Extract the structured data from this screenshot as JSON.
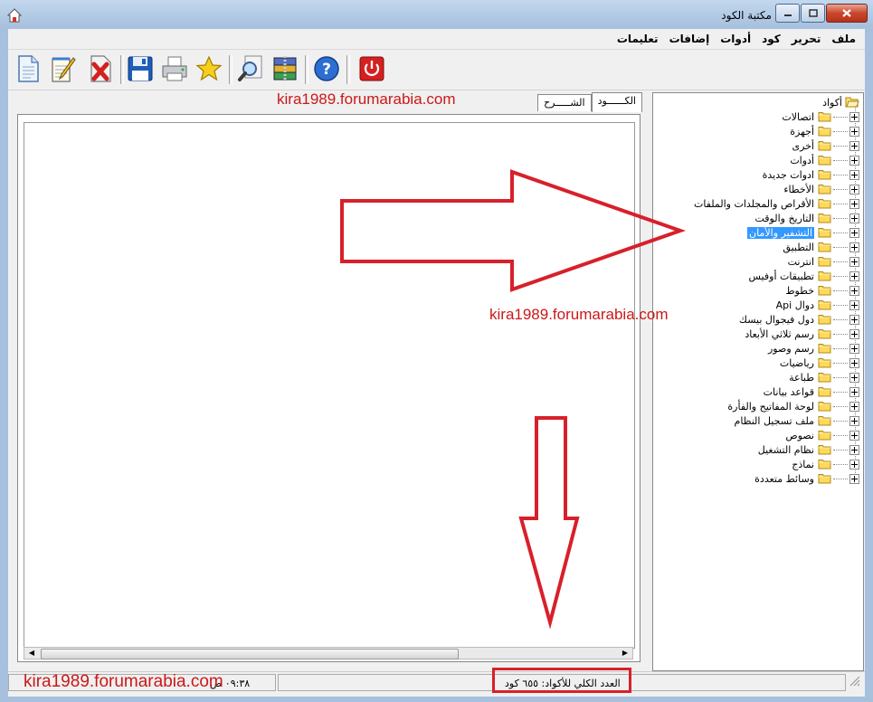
{
  "window": {
    "title": "مكتبة الكود"
  },
  "menu": [
    "ملف",
    "تحرير",
    "كود",
    "أدوات",
    "إضافات",
    "تعليمات"
  ],
  "toolbar": [
    {
      "name": "new-document",
      "icon": "document-icon"
    },
    {
      "name": "edit",
      "icon": "notepad-pencil-icon"
    },
    {
      "name": "delete",
      "icon": "red-x-icon"
    },
    {
      "name": "save",
      "icon": "floppy-disk-icon"
    },
    {
      "name": "print",
      "icon": "printer-icon"
    },
    {
      "name": "favorites",
      "icon": "star-icon"
    },
    {
      "name": "search",
      "icon": "magnifier-icon"
    },
    {
      "name": "archive",
      "icon": "winzip-icon"
    },
    {
      "name": "help",
      "icon": "question-icon"
    },
    {
      "name": "exit",
      "icon": "power-icon"
    }
  ],
  "tabs": {
    "code": "الكــــــود",
    "explanation": "الشـــــرح"
  },
  "watermark": "kira1989.forumarabia.com",
  "tree": {
    "root": "أكواد",
    "items": [
      "اتصالات",
      "أجهزة",
      "أخرى",
      "أدوات",
      "ادوات جديدة",
      "الأخطاء",
      "الأقراص والمجلدات والملفات",
      "التاريخ والوقت",
      "التشفير والأمان",
      "التطبيق",
      "انترنت",
      "تطبيقات أوفيس",
      "خطوط",
      "دوال Api",
      "دول فيجوال بيسك",
      "رسم ثلاثي الأبعاد",
      "رسم وصور",
      "رياضيات",
      "طباعة",
      "قواعد بيانات",
      "لوحة المفاتيح والفأرة",
      "ملف تسجيل النظام",
      "نصوص",
      "نظام التشغيل",
      "نماذج",
      "وسائط متعددة"
    ],
    "selected_index": 8
  },
  "status": {
    "total_codes": "العدد الكلي للأكواد: ٦٥٥ كود",
    "time": "٠٩:٣٨ ص"
  },
  "colors": {
    "annotation_red": "#d8202a",
    "selection": "#3399ff"
  }
}
